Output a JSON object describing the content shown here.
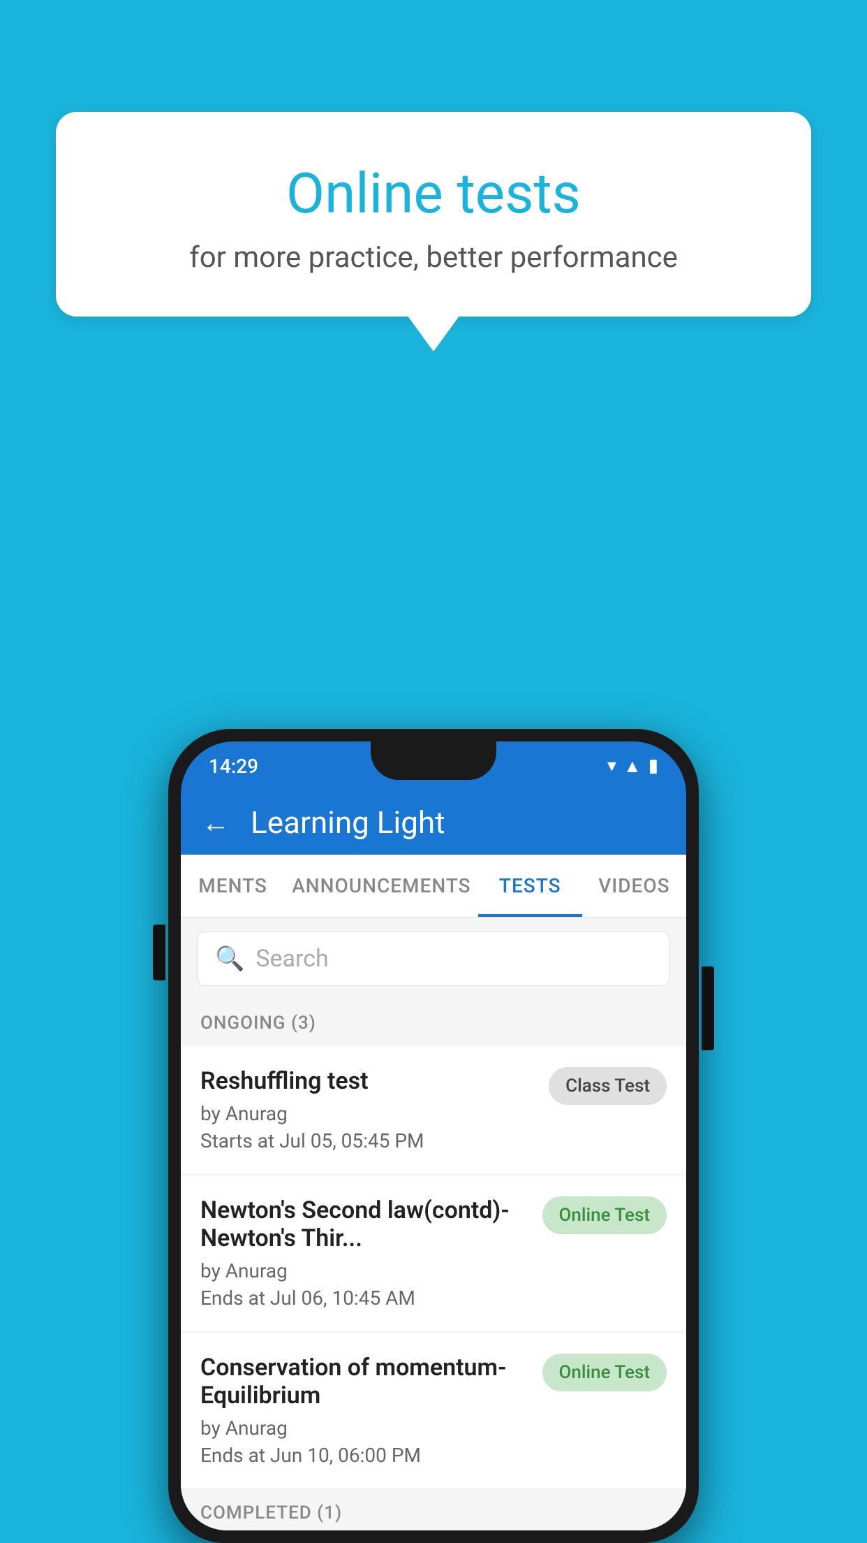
{
  "background_color": "#1ab3dc",
  "bubble": {
    "title": "Online tests",
    "subtitle": "for more practice, better performance"
  },
  "phone": {
    "status_bar": {
      "time": "14:29",
      "icons": [
        "wifi",
        "signal",
        "battery"
      ]
    },
    "app_header": {
      "title": "Learning Light",
      "back_label": "←"
    },
    "tabs": [
      {
        "label": "MENTS",
        "active": false
      },
      {
        "label": "ANNOUNCEMENTS",
        "active": false
      },
      {
        "label": "TESTS",
        "active": true
      },
      {
        "label": "VIDEOS",
        "active": false
      }
    ],
    "search": {
      "placeholder": "Search",
      "icon": "🔍"
    },
    "ongoing_section": {
      "header": "ONGOING (3)",
      "tests": [
        {
          "name": "Reshuffling test",
          "author": "by Anurag",
          "time_label": "Starts at",
          "time": "Jul 05, 05:45 PM",
          "badge": "Class Test",
          "badge_type": "class"
        },
        {
          "name": "Newton's Second law(contd)-Newton's Thir...",
          "author": "by Anurag",
          "time_label": "Ends at",
          "time": "Jul 06, 10:45 AM",
          "badge": "Online Test",
          "badge_type": "online"
        },
        {
          "name": "Conservation of momentum-Equilibrium",
          "author": "by Anurag",
          "time_label": "Ends at",
          "time": "Jun 10, 06:00 PM",
          "badge": "Online Test",
          "badge_type": "online"
        }
      ]
    },
    "completed_section": {
      "header": "COMPLETED (1)"
    }
  }
}
